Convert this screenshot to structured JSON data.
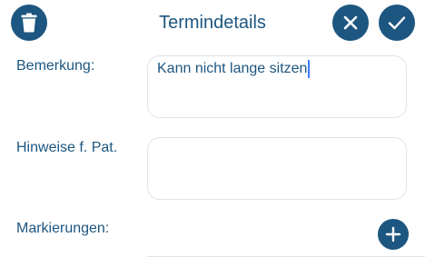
{
  "header": {
    "title": "Termindetails",
    "delete_icon": "trash-icon",
    "cancel_icon": "close-icon",
    "confirm_icon": "checkmark-icon"
  },
  "form": {
    "bemerkung": {
      "label": "Bemerkung:",
      "value": "Kann nicht lange sitzen"
    },
    "hinweise": {
      "label": "Hinweise f. Pat.",
      "value": ""
    },
    "markierungen": {
      "label": "Markierungen:",
      "add_icon": "plus-icon"
    }
  },
  "colors": {
    "primary": "#1d5680",
    "caret": "#3d7cff",
    "border": "#dfe3e8"
  }
}
